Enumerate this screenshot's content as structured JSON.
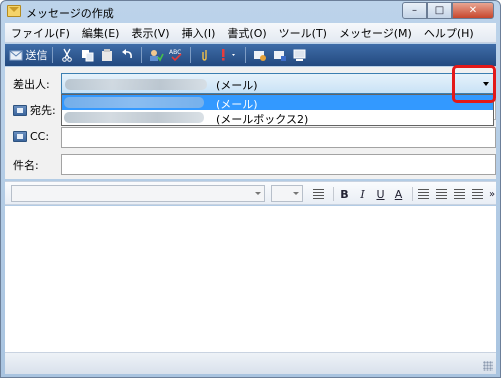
{
  "window": {
    "title": "メッセージの作成",
    "controls": {
      "minimize": "–",
      "maximize": "□",
      "close": "✕"
    }
  },
  "menu": [
    "ファイル(F)",
    "編集(E)",
    "表示(V)",
    "挿入(I)",
    "書式(O)",
    "ツール(T)",
    "メッセージ(M)",
    "ヘルプ(H)"
  ],
  "toolbar": {
    "send_label": "送信",
    "icons": [
      "send-icon",
      "cut-icon",
      "copy-icon",
      "paste-icon",
      "undo-icon",
      "check-names-icon",
      "spelling-icon",
      "attach-icon",
      "priority-icon",
      "sign-icon",
      "encrypt-icon",
      "offline-icon"
    ]
  },
  "headers": {
    "from_label": "差出人:",
    "to_label": "宛先:",
    "cc_label": "CC:",
    "subject_label": "件名:",
    "from_value": "(メール)",
    "to_value": "",
    "cc_value": "",
    "subject_value": ""
  },
  "from_dropdown": {
    "options": [
      {
        "text": "(メール)",
        "selected": true
      },
      {
        "text": "(メールボックス2)",
        "selected": false
      }
    ]
  },
  "format_toolbar": {
    "font_value": "",
    "size_value": "",
    "bold": "B",
    "italic": "I",
    "underline": "U",
    "font_color": "A",
    "more": "»"
  },
  "body_text": "",
  "colors": {
    "highlight": "#e31818",
    "selection": "#3399ff",
    "toolbar": "#2d578f"
  }
}
